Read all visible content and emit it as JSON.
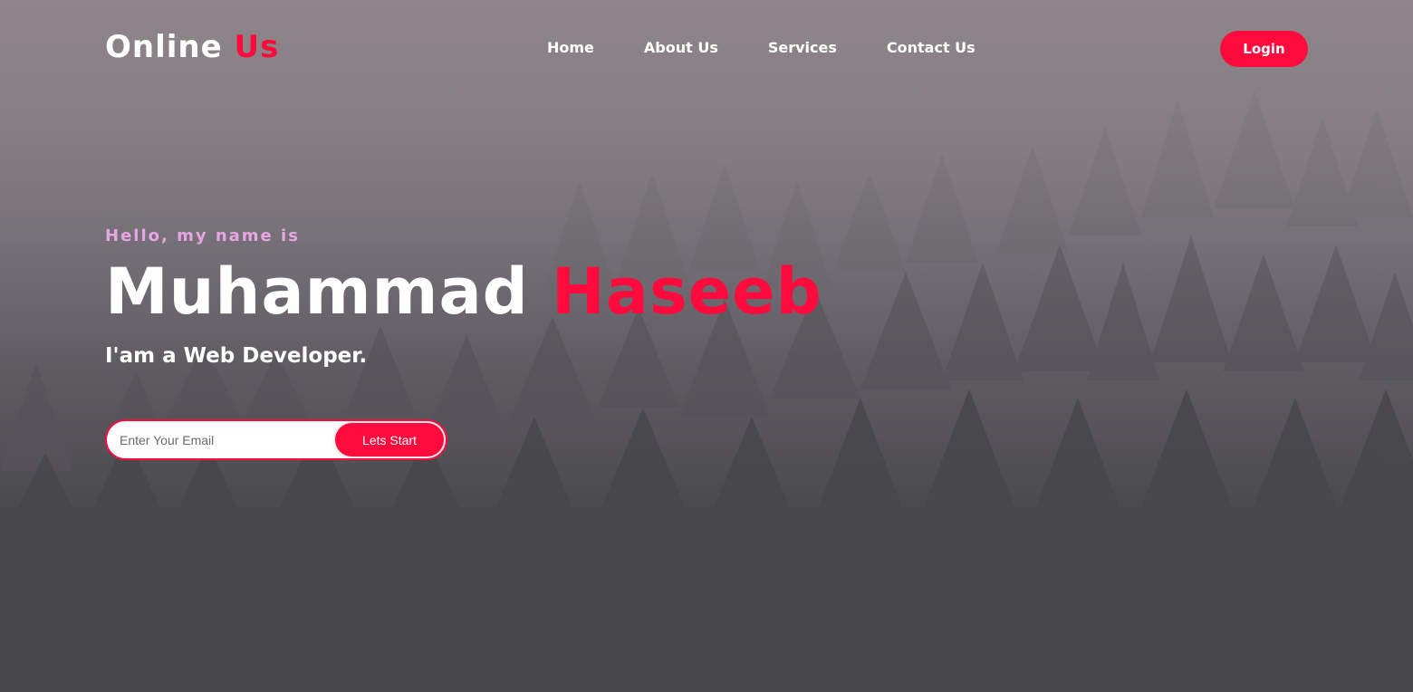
{
  "colors": {
    "accent": "#ff0a3c",
    "greeting": "#e7a5e3",
    "text": "#ffffff",
    "background_top": "#948a8f",
    "background_bottom": "#464548"
  },
  "navbar": {
    "brand_first": "Online",
    "brand_second": "Us",
    "links": [
      "Home",
      "About Us",
      "Services",
      "Contact Us"
    ],
    "login_label": "Login"
  },
  "hero": {
    "greeting": "Hello, my name is",
    "first_name": "Muhammad",
    "last_name": "Haseeb",
    "tagline": "I'am a Web Developer."
  },
  "signup": {
    "placeholder": "Enter Your Email",
    "value": "",
    "button_label": "Lets Start"
  },
  "background": {
    "image": "misty-forest"
  }
}
